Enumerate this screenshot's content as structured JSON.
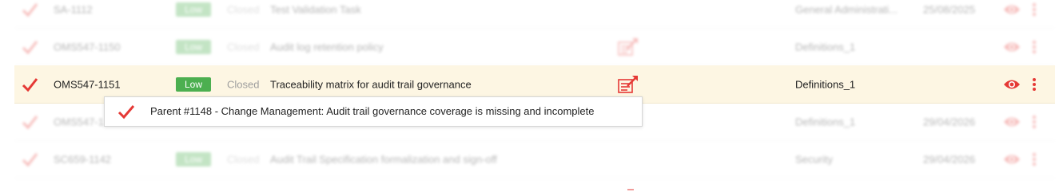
{
  "colors": {
    "accent_red": "#e53935",
    "priority_low": "#4caf50",
    "active_row_bg": "#fdf6e3"
  },
  "rows": [
    {
      "id": "SA-1112",
      "priority": "Low",
      "status": "Closed",
      "title": "Test Validation Task",
      "category": "General Administrati...",
      "date": "25/08/2025"
    },
    {
      "id": "OMS547-1150",
      "priority": "Low",
      "status": "Closed",
      "title": "Audit log retention policy",
      "category": "Definitions_1",
      "date": ""
    },
    {
      "id": "OMS547-1151",
      "priority": "Low",
      "status": "Closed",
      "title": "Traceability matrix for audit trail governance",
      "category": "Definitions_1",
      "date": ""
    },
    {
      "id": "OMS547-1",
      "priority": "Low",
      "status": "Closed",
      "title": "",
      "category": "Definitions_1",
      "date": "29/04/2026"
    },
    {
      "id": "SC659-1142",
      "priority": "Low",
      "status": "Closed",
      "title": "Audit Trail Specification formalization and sign-off",
      "category": "Security",
      "date": "29/04/2026"
    }
  ],
  "tooltip": {
    "text": "Parent #1148 - Change Management: Audit trail governance coverage is missing and incomplete"
  },
  "icons": {
    "row_check": "checkmark-icon",
    "matrix": "traceability-matrix-icon",
    "view": "eye-icon",
    "menu": "kebab-menu-icon"
  }
}
